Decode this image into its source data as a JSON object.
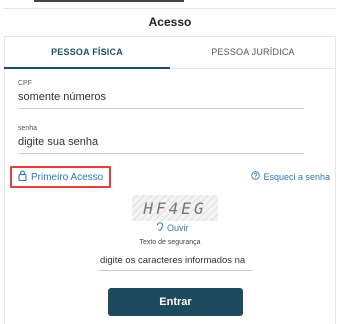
{
  "header": {
    "title": "Acesso"
  },
  "tabs": [
    {
      "label": "PESSOA FÍSICA",
      "active": true
    },
    {
      "label": "PESSOA JURÍDICA",
      "active": false
    }
  ],
  "form": {
    "cpf_label": "CPF",
    "cpf_placeholder": "somente números",
    "senha_label": "senha",
    "senha_placeholder": "digite sua senha"
  },
  "links": {
    "primeiro_acesso": "Primeiro Acesso",
    "primeiro_icon": "lock-icon",
    "esqueci": "Esqueci a senha",
    "esqueci_icon": "help-circle-icon"
  },
  "captcha": {
    "image_text": "HF4EG",
    "ouvir": "Ouvir",
    "ouvir_icon": "ear-icon",
    "label": "Texto de segurança",
    "placeholder": "digite os caracteres informados na"
  },
  "submit_label": "Entrar",
  "colors": {
    "primary": "#1e4a5e",
    "link": "#2b7ab5",
    "highlight": "#e2403f"
  }
}
